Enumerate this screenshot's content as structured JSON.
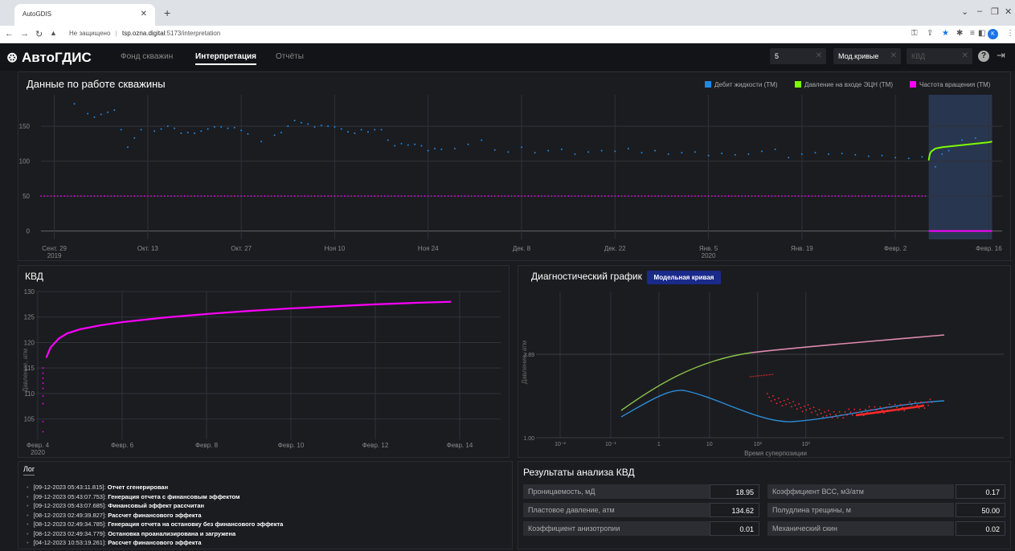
{
  "browser": {
    "tab_title": "AutoGDIS",
    "url_warning": "Не защищено",
    "url_host": "tsp.ozna.digital",
    "url_path": ":5173/interpretation",
    "avatar_letter": "K"
  },
  "app": {
    "logo": "АвтоГДИС",
    "menu": [
      "Фонд скважин",
      "Интерпретация",
      "Отчёты"
    ],
    "active_menu": "Интерпретация",
    "well_input": "5",
    "curve_select": "Мод.кривые",
    "third_select": "КВД"
  },
  "top_chart": {
    "title": "Данные по работе скважины",
    "legend": [
      {
        "label": "Дебит жидкости (ТМ)",
        "color": "#1e88e5"
      },
      {
        "label": "Давление на входе ЭЦН (ТМ)",
        "color": "#7cfc00"
      },
      {
        "label": "Частота вращения (ТМ)",
        "color": "#ff00ff"
      }
    ],
    "x_ticks": [
      {
        "label": "Сент. 29",
        "sub": "2019"
      },
      {
        "label": "Окт. 13",
        "sub": ""
      },
      {
        "label": "Окт. 27",
        "sub": ""
      },
      {
        "label": "Ноя 10",
        "sub": ""
      },
      {
        "label": "Ноя 24",
        "sub": ""
      },
      {
        "label": "Дек. 8",
        "sub": ""
      },
      {
        "label": "Дек. 22",
        "sub": ""
      },
      {
        "label": "Янв. 5",
        "sub": "2020"
      },
      {
        "label": "Янв. 19",
        "sub": ""
      },
      {
        "label": "Февр. 2",
        "sub": ""
      },
      {
        "label": "Февр. 16",
        "sub": ""
      }
    ],
    "y_ticks": [
      "150",
      "100",
      "50",
      "0"
    ]
  },
  "chart_data": [
    {
      "type": "scatter",
      "title": "Данные по работе скважины",
      "x_range": [
        "2019-09-27",
        "2020-02-18"
      ],
      "ylim": [
        -12,
        195
      ],
      "series": [
        {
          "name": "Дебит жидкости (ТМ)",
          "day": [
            5,
            7,
            8,
            9,
            10,
            11,
            12,
            13,
            14,
            15,
            17,
            18,
            19,
            20,
            21,
            22,
            23,
            24,
            25,
            26,
            27,
            28,
            29,
            30,
            31,
            33,
            35,
            36,
            37,
            38,
            39,
            40,
            41,
            42,
            43,
            44,
            45,
            46,
            47,
            48,
            49,
            50,
            51,
            52,
            53,
            54,
            55,
            56,
            57,
            58,
            59,
            60,
            62,
            64,
            66,
            68,
            70,
            72,
            74,
            76,
            78,
            80,
            82,
            84,
            86,
            88,
            90,
            92,
            94,
            96,
            98,
            100,
            102,
            104,
            106,
            108,
            110,
            112,
            114,
            116,
            118,
            120,
            122,
            124,
            126,
            128,
            130,
            132,
            133,
            134,
            135,
            136,
            138,
            140
          ],
          "y": [
            182,
            168,
            163,
            167,
            170,
            173,
            145,
            120,
            133,
            145,
            143,
            146,
            150,
            147,
            140,
            141,
            140,
            143,
            146,
            149,
            149,
            147,
            148,
            144,
            139,
            128,
            137,
            141,
            150,
            158,
            155,
            153,
            149,
            151,
            150,
            149,
            146,
            142,
            140,
            145,
            142,
            145,
            145,
            130,
            122,
            125,
            123,
            124,
            122,
            115,
            118,
            117,
            118,
            124,
            130,
            116,
            113,
            120,
            112,
            115,
            117,
            110,
            113,
            115,
            114,
            118,
            112,
            115,
            110,
            112,
            113,
            108,
            111,
            109,
            110,
            114,
            117,
            105,
            110,
            112,
            110,
            111,
            109,
            107,
            108,
            105,
            104,
            106,
            103,
            92,
            110,
            115,
            130,
            133
          ]
        },
        {
          "name": "Давление на входе ЭЦН (ТМ)",
          "day": [
            133.0,
            133.1,
            133.2,
            133.4,
            133.7,
            134.0,
            134.5,
            135,
            136,
            137,
            138,
            139,
            140,
            141,
            142,
            142.5
          ],
          "y": [
            101,
            107,
            111,
            114,
            116,
            118,
            119,
            120,
            121,
            122,
            123,
            124,
            125,
            126,
            127,
            128
          ]
        },
        {
          "name": "Частота вращения (ТМ)",
          "level": 50,
          "shutdown_level": 0
        }
      ]
    },
    {
      "type": "line",
      "title": "КВД",
      "ylabel": "Давление, атм",
      "x": [
        "Февр. 4",
        "Февр. 6",
        "Февр. 8",
        "Февр. 10",
        "Февр. 12",
        "Февр. 14"
      ],
      "ylim": [
        101,
        130
      ],
      "series": [
        {
          "name": "",
          "t_days": [
            0.2,
            0.3,
            0.5,
            0.7,
            1.0,
            1.5,
            2,
            3,
            4,
            5,
            6,
            7,
            8,
            9,
            9.8
          ],
          "y": [
            117,
            119,
            120.8,
            121.8,
            122.6,
            123.4,
            124.0,
            124.9,
            125.6,
            126.2,
            126.7,
            127.1,
            127.5,
            127.8,
            128.0
          ]
        }
      ]
    },
    {
      "type": "scatter",
      "title": "Диагностический график",
      "xlabel": "Время суперпозиции",
      "ylabel": "Давление, атм"
    }
  ],
  "kvd": {
    "title": "КВД",
    "y_ticks": [
      "130",
      "125",
      "120",
      "115",
      "110",
      "105"
    ],
    "x_ticks": [
      {
        "label": "Февр. 4",
        "sub": "2020"
      },
      {
        "label": "Февр. 6",
        "sub": ""
      },
      {
        "label": "Февр. 8",
        "sub": ""
      },
      {
        "label": "Февр. 10",
        "sub": ""
      },
      {
        "label": "Февр. 12",
        "sub": ""
      },
      {
        "label": "Февр. 14",
        "sub": ""
      }
    ],
    "ylabel": "Давление, атм"
  },
  "diag": {
    "title": "Диагностический график",
    "model_button": "Модельная кривая",
    "ylabel": "Давление, атм",
    "xlabel": "Время суперпозиции",
    "y_label_top": "3.89",
    "y_label_bottom": "1.00"
  },
  "log": {
    "tab": "Лог",
    "lines": [
      {
        "ts": "[09-12-2023 05:43:11.815]:",
        "msg": "Отчет сгенерирован"
      },
      {
        "ts": "[09-12-2023 05:43:07.753]:",
        "msg": "Генерация отчета с финансовым эффектом"
      },
      {
        "ts": "[09-12-2023 05:43:07.685]:",
        "msg": "Финансовый эффект рассчитан"
      },
      {
        "ts": "[08-12-2023 02:49:39.827]:",
        "msg": "Рассчет финансового эффекта"
      },
      {
        "ts": "[08-12-2023 02:49:34.785]:",
        "msg": "Генерация отчета на остановку без финансового эффекта"
      },
      {
        "ts": "[08-12-2023 02:49:34.779]:",
        "msg": "Остановка проанализирована и загружена"
      },
      {
        "ts": "[04-12-2023 10:53:19.261]:",
        "msg": "Рассчет финансового эффекта"
      }
    ]
  },
  "results": {
    "title": "Результаты анализа КВД",
    "left": [
      {
        "label": "Проницаемость, мД",
        "value": "18.95"
      },
      {
        "label": "Пластовое давление, атм",
        "value": "134.62"
      },
      {
        "label": "Коэффициент анизотропии",
        "value": "0.01"
      }
    ],
    "right": [
      {
        "label": "Коэффициент ВСС, м3/атм",
        "value": "0.17"
      },
      {
        "label": "Полудлина трещины, м",
        "value": "50.00"
      },
      {
        "label": "Механический скин",
        "value": "0.02"
      }
    ]
  },
  "colors": {
    "debit": "#1e88e5",
    "pressure": "#7cfc00",
    "freq": "#ff00ff",
    "derivative": "#ff2a2a",
    "model_deriv": "#2b8cd6",
    "highlight": "#2b3a55"
  }
}
